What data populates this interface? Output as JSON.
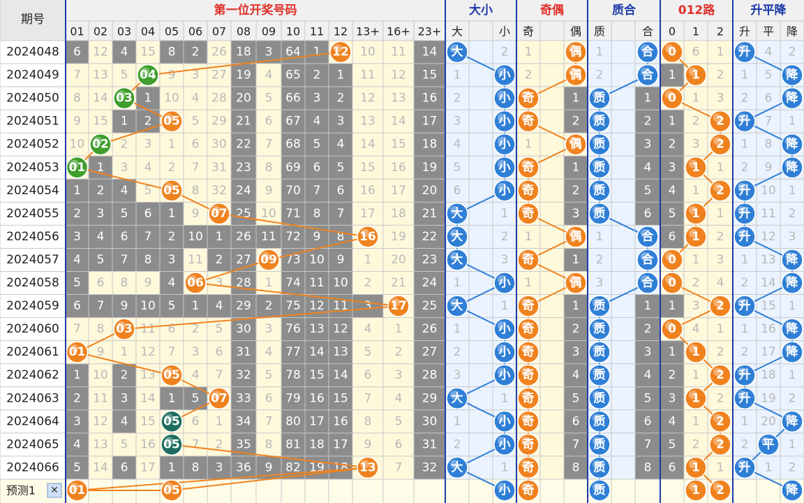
{
  "colors": {
    "background": "#fff9db",
    "background_light": "#fffde8",
    "blue_zone": "#eaf3ff",
    "header_bg": "#f0f0f0",
    "grid": "#c8c8c8",
    "gray_cell": "#8c8c8c",
    "title_red": "#e0302a",
    "title_blue": "#1b3aa8",
    "orange": "#f0821e",
    "green": "#3f9e2c",
    "teal": "#1d6e5e",
    "blue_ball": "#2f7fd6",
    "separator": "#1b3aa8"
  },
  "header": {
    "period_label": "期号",
    "groups": [
      {
        "label": "第一位开奖号码",
        "color": "red"
      },
      {
        "label": "大小",
        "color": "blue"
      },
      {
        "label": "奇偶",
        "color": "red"
      },
      {
        "label": "质合",
        "color": "blue"
      },
      {
        "label": "012路",
        "color": "red"
      },
      {
        "label": "升平降",
        "color": "blue"
      }
    ],
    "columns": [
      "01",
      "02",
      "03",
      "04",
      "05",
      "06",
      "07",
      "08",
      "09",
      "10",
      "11",
      "12",
      "13+",
      "16+",
      "23+",
      "大",
      "",
      "小",
      "奇",
      "",
      "偶",
      "质",
      "",
      "合",
      "0",
      "1",
      "2",
      "升",
      "平",
      "降"
    ]
  },
  "chart_data": {
    "type": "table",
    "periods": [
      "2024048",
      "2024049",
      "2024050",
      "2024051",
      "2024052",
      "2024053",
      "2024054",
      "2024055",
      "2024056",
      "2024057",
      "2024058",
      "2024059",
      "2024060",
      "2024061",
      "2024062",
      "2024063",
      "2024064",
      "2024065",
      "2024066"
    ],
    "rows": [
      {
        "n": [
          "6",
          "12",
          "4",
          "15",
          "8",
          "2",
          "26",
          "18",
          "3",
          "64",
          "1",
          "12",
          "10",
          "11",
          "14"
        ],
        "dx": [
          "大",
          "",
          "2"
        ],
        "jo": [
          "1",
          "",
          "偶"
        ],
        "zh": [
          "1",
          "",
          "合"
        ],
        "r": [
          "0",
          "6",
          "1"
        ],
        "spj": [
          "升",
          "4",
          "2"
        ]
      },
      {
        "n": [
          "7",
          "13",
          "5",
          "04",
          "9",
          "3",
          "27",
          "19",
          "4",
          "65",
          "2",
          "1",
          "11",
          "12",
          "15"
        ],
        "dx": [
          "1",
          "",
          "小"
        ],
        "jo": [
          "2",
          "",
          "偶"
        ],
        "zh": [
          "2",
          "",
          "合"
        ],
        "r": [
          "1",
          "1",
          "2"
        ],
        "spj": [
          "1",
          "5",
          "降"
        ]
      },
      {
        "n": [
          "8",
          "14",
          "03",
          "1",
          "10",
          "4",
          "28",
          "20",
          "5",
          "66",
          "3",
          "2",
          "12",
          "13",
          "16"
        ],
        "dx": [
          "2",
          "",
          "小"
        ],
        "jo": [
          "奇",
          "",
          "1"
        ],
        "zh": [
          "质",
          "",
          "1"
        ],
        "r": [
          "0",
          "1",
          "3"
        ],
        "spj": [
          "2",
          "6",
          "降"
        ]
      },
      {
        "n": [
          "9",
          "15",
          "1",
          "2",
          "05",
          "5",
          "29",
          "21",
          "6",
          "67",
          "4",
          "3",
          "13",
          "14",
          "17"
        ],
        "dx": [
          "3",
          "",
          "小"
        ],
        "jo": [
          "奇",
          "",
          "2"
        ],
        "zh": [
          "质",
          "",
          "2"
        ],
        "r": [
          "1",
          "2",
          "2"
        ],
        "spj": [
          "升",
          "7",
          "1"
        ]
      },
      {
        "n": [
          "10",
          "02",
          "2",
          "3",
          "1",
          "6",
          "30",
          "22",
          "7",
          "68",
          "5",
          "4",
          "14",
          "15",
          "18"
        ],
        "dx": [
          "4",
          "",
          "小"
        ],
        "jo": [
          "1",
          "",
          "偶"
        ],
        "zh": [
          "质",
          "",
          "3"
        ],
        "r": [
          "2",
          "3",
          "2"
        ],
        "spj": [
          "1",
          "8",
          "降"
        ]
      },
      {
        "n": [
          "01",
          "1",
          "3",
          "4",
          "2",
          "7",
          "31",
          "23",
          "8",
          "69",
          "6",
          "5",
          "15",
          "16",
          "19"
        ],
        "dx": [
          "5",
          "",
          "小"
        ],
        "jo": [
          "奇",
          "",
          "1"
        ],
        "zh": [
          "质",
          "",
          "4"
        ],
        "r": [
          "3",
          "1",
          "1"
        ],
        "spj": [
          "2",
          "9",
          "降"
        ]
      },
      {
        "n": [
          "1",
          "2",
          "4",
          "5",
          "05",
          "8",
          "32",
          "24",
          "9",
          "70",
          "7",
          "6",
          "16",
          "17",
          "20"
        ],
        "dx": [
          "6",
          "",
          "小"
        ],
        "jo": [
          "奇",
          "",
          "2"
        ],
        "zh": [
          "质",
          "",
          "5"
        ],
        "r": [
          "4",
          "1",
          "2"
        ],
        "spj": [
          "升",
          "10",
          "1"
        ]
      },
      {
        "n": [
          "2",
          "3",
          "5",
          "6",
          "1",
          "9",
          "07",
          "25",
          "10",
          "71",
          "8",
          "7",
          "17",
          "18",
          "21"
        ],
        "dx": [
          "大",
          "",
          "1"
        ],
        "jo": [
          "奇",
          "",
          "3"
        ],
        "zh": [
          "质",
          "",
          "6"
        ],
        "r": [
          "5",
          "1",
          "1"
        ],
        "spj": [
          "升",
          "11",
          "2"
        ]
      },
      {
        "n": [
          "3",
          "4",
          "6",
          "7",
          "2",
          "10",
          "1",
          "26",
          "11",
          "72",
          "9",
          "8",
          "16",
          "19",
          "22"
        ],
        "dx": [
          "大",
          "",
          "2"
        ],
        "jo": [
          "1",
          "",
          "偶"
        ],
        "zh": [
          "1",
          "",
          "合"
        ],
        "r": [
          "6",
          "1",
          "2"
        ],
        "spj": [
          "升",
          "12",
          "3"
        ]
      },
      {
        "n": [
          "4",
          "5",
          "7",
          "8",
          "3",
          "11",
          "2",
          "27",
          "09",
          "73",
          "10",
          "9",
          "1",
          "20",
          "23"
        ],
        "dx": [
          "大",
          "",
          "3"
        ],
        "jo": [
          "奇",
          "",
          "1"
        ],
        "zh": [
          "2",
          "",
          "合"
        ],
        "r": [
          "0",
          "1",
          "3"
        ],
        "spj": [
          "1",
          "13",
          "降"
        ]
      },
      {
        "n": [
          "5",
          "6",
          "8",
          "9",
          "4",
          "06",
          "3",
          "28",
          "1",
          "74",
          "11",
          "10",
          "2",
          "21",
          "24"
        ],
        "dx": [
          "1",
          "",
          "小"
        ],
        "jo": [
          "1",
          "",
          "偶"
        ],
        "zh": [
          "3",
          "",
          "合"
        ],
        "r": [
          "0",
          "2",
          "4"
        ],
        "spj": [
          "2",
          "14",
          "降"
        ]
      },
      {
        "n": [
          "6",
          "7",
          "9",
          "10",
          "5",
          "1",
          "4",
          "29",
          "2",
          "75",
          "12",
          "11",
          "3",
          "17",
          "25"
        ],
        "dx": [
          "大",
          "",
          "1"
        ],
        "jo": [
          "奇",
          "",
          "1"
        ],
        "zh": [
          "质",
          "",
          "1"
        ],
        "r": [
          "1",
          "3",
          "2"
        ],
        "spj": [
          "升",
          "15",
          "1"
        ]
      },
      {
        "n": [
          "7",
          "8",
          "03",
          "11",
          "6",
          "2",
          "5",
          "30",
          "3",
          "76",
          "13",
          "12",
          "4",
          "1",
          "26"
        ],
        "dx": [
          "1",
          "",
          "小"
        ],
        "jo": [
          "奇",
          "",
          "2"
        ],
        "zh": [
          "质",
          "",
          "2"
        ],
        "r": [
          "0",
          "4",
          "1"
        ],
        "spj": [
          "1",
          "16",
          "降"
        ]
      },
      {
        "n": [
          "01",
          "9",
          "1",
          "12",
          "7",
          "3",
          "6",
          "31",
          "4",
          "77",
          "14",
          "13",
          "5",
          "2",
          "27"
        ],
        "dx": [
          "2",
          "",
          "小"
        ],
        "jo": [
          "奇",
          "",
          "3"
        ],
        "zh": [
          "质",
          "",
          "3"
        ],
        "r": [
          "1",
          "1",
          "2"
        ],
        "spj": [
          "2",
          "17",
          "降"
        ]
      },
      {
        "n": [
          "1",
          "10",
          "2",
          "13",
          "05",
          "4",
          "7",
          "32",
          "5",
          "78",
          "15",
          "14",
          "6",
          "3",
          "28"
        ],
        "dx": [
          "3",
          "",
          "小"
        ],
        "jo": [
          "奇",
          "",
          "4"
        ],
        "zh": [
          "质",
          "",
          "4"
        ],
        "r": [
          "2",
          "1",
          "2"
        ],
        "spj": [
          "升",
          "18",
          "1"
        ]
      },
      {
        "n": [
          "2",
          "11",
          "3",
          "14",
          "1",
          "5",
          "07",
          "33",
          "6",
          "79",
          "16",
          "15",
          "7",
          "4",
          "29"
        ],
        "dx": [
          "大",
          "",
          "1"
        ],
        "jo": [
          "奇",
          "",
          "5"
        ],
        "zh": [
          "质",
          "",
          "5"
        ],
        "r": [
          "3",
          "1",
          "2"
        ],
        "spj": [
          "升",
          "19",
          "2"
        ]
      },
      {
        "n": [
          "3",
          "12",
          "4",
          "15",
          "05",
          "6",
          "1",
          "34",
          "7",
          "80",
          "17",
          "16",
          "8",
          "5",
          "30"
        ],
        "dx": [
          "1",
          "",
          "小"
        ],
        "jo": [
          "奇",
          "",
          "6"
        ],
        "zh": [
          "质",
          "",
          "6"
        ],
        "r": [
          "4",
          "1",
          "2"
        ],
        "spj": [
          "1",
          "20",
          "降"
        ]
      },
      {
        "n": [
          "4",
          "13",
          "5",
          "16",
          "05",
          "7",
          "2",
          "35",
          "8",
          "81",
          "18",
          "17",
          "9",
          "6",
          "31"
        ],
        "dx": [
          "2",
          "",
          "小"
        ],
        "jo": [
          "奇",
          "",
          "7"
        ],
        "zh": [
          "质",
          "",
          "7"
        ],
        "r": [
          "5",
          "2",
          "2"
        ],
        "spj": [
          "2",
          "平",
          "1"
        ]
      },
      {
        "n": [
          "5",
          "14",
          "6",
          "17",
          "1",
          "8",
          "3",
          "36",
          "9",
          "82",
          "19",
          "18",
          "13",
          "7",
          "32"
        ],
        "dx": [
          "大",
          "",
          "1"
        ],
        "jo": [
          "奇",
          "",
          "8"
        ],
        "zh": [
          "质",
          "",
          "8"
        ],
        "r": [
          "6",
          "1",
          "1"
        ],
        "spj": [
          "升",
          "1",
          "2"
        ]
      }
    ],
    "ball_style": [
      {
        "n": {
          "11": "orange"
        },
        "b": {
          "15": 1,
          "20": 1,
          "23": 1,
          "24": 1,
          "27": 1
        }
      },
      {
        "n": {
          "3": "green"
        },
        "b": {
          "17": 1,
          "20": 1,
          "23": 1,
          "25": 1,
          "29": 1
        }
      },
      {
        "n": {
          "2": "green"
        },
        "b": {
          "17": 1,
          "18": 1,
          "21": 1,
          "24": 1,
          "29": 1
        }
      },
      {
        "n": {
          "4": "orange"
        },
        "b": {
          "17": 1,
          "18": 1,
          "21": 1,
          "26": 1,
          "27": 1
        }
      },
      {
        "n": {
          "1": "green"
        },
        "b": {
          "17": 1,
          "20": 1,
          "21": 1,
          "26": 1,
          "29": 1
        }
      },
      {
        "n": {
          "0": "green"
        },
        "b": {
          "17": 1,
          "18": 1,
          "21": 1,
          "25": 1,
          "29": 1
        }
      },
      {
        "n": {
          "4": "orange"
        },
        "b": {
          "17": 1,
          "18": 1,
          "21": 1,
          "26": 1,
          "27": 1
        }
      },
      {
        "n": {
          "6": "orange"
        },
        "b": {
          "15": 1,
          "18": 1,
          "21": 1,
          "25": 1,
          "27": 1
        }
      },
      {
        "n": {
          "12": "orange"
        },
        "b": {
          "15": 1,
          "20": 1,
          "23": 1,
          "25": 1,
          "27": 1
        }
      },
      {
        "n": {
          "8": "orange"
        },
        "b": {
          "15": 1,
          "18": 1,
          "23": 1,
          "24": 1,
          "29": 1
        }
      },
      {
        "n": {
          "5": "orange"
        },
        "b": {
          "17": 1,
          "20": 1,
          "23": 1,
          "24": 1,
          "29": 1
        }
      },
      {
        "n": {
          "13": "orange"
        },
        "b": {
          "15": 1,
          "18": 1,
          "21": 1,
          "26": 1,
          "27": 1
        }
      },
      {
        "n": {
          "2": "orange"
        },
        "b": {
          "17": 1,
          "18": 1,
          "21": 1,
          "24": 1,
          "29": 1
        }
      },
      {
        "n": {
          "0": "orange"
        },
        "b": {
          "17": 1,
          "18": 1,
          "21": 1,
          "25": 1,
          "29": 1
        }
      },
      {
        "n": {
          "4": "orange"
        },
        "b": {
          "17": 1,
          "18": 1,
          "21": 1,
          "26": 1,
          "27": 1
        }
      },
      {
        "n": {
          "6": "orange"
        },
        "b": {
          "15": 1,
          "18": 1,
          "21": 1,
          "25": 1,
          "27": 1
        }
      },
      {
        "n": {
          "4": "teal"
        },
        "b": {
          "17": 1,
          "18": 1,
          "21": 1,
          "26": 1,
          "29": 1
        }
      },
      {
        "n": {
          "4": "teal"
        },
        "b": {
          "17": 1,
          "18": 1,
          "21": 1,
          "26": 1,
          "28": 1
        }
      },
      {
        "n": {
          "12": "orange"
        },
        "b": {
          "15": 1,
          "18": 1,
          "21": 1,
          "25": 1,
          "27": 1
        }
      }
    ],
    "prediction": {
      "label": "预测1",
      "close_symbol": "✕",
      "balls": [
        {
          "col": 0,
          "text": "01",
          "style": "orange"
        },
        {
          "col": 4,
          "text": "05",
          "style": "orange"
        },
        {
          "col": 17,
          "text": "小",
          "style": "blue"
        },
        {
          "col": 18,
          "text": "奇",
          "style": "orange"
        },
        {
          "col": 21,
          "text": "质",
          "style": "blue"
        },
        {
          "col": 25,
          "text": "1",
          "style": "orange"
        },
        {
          "col": 26,
          "text": "2",
          "style": "orange"
        },
        {
          "col": 29,
          "text": "降",
          "style": "blue"
        }
      ]
    }
  }
}
